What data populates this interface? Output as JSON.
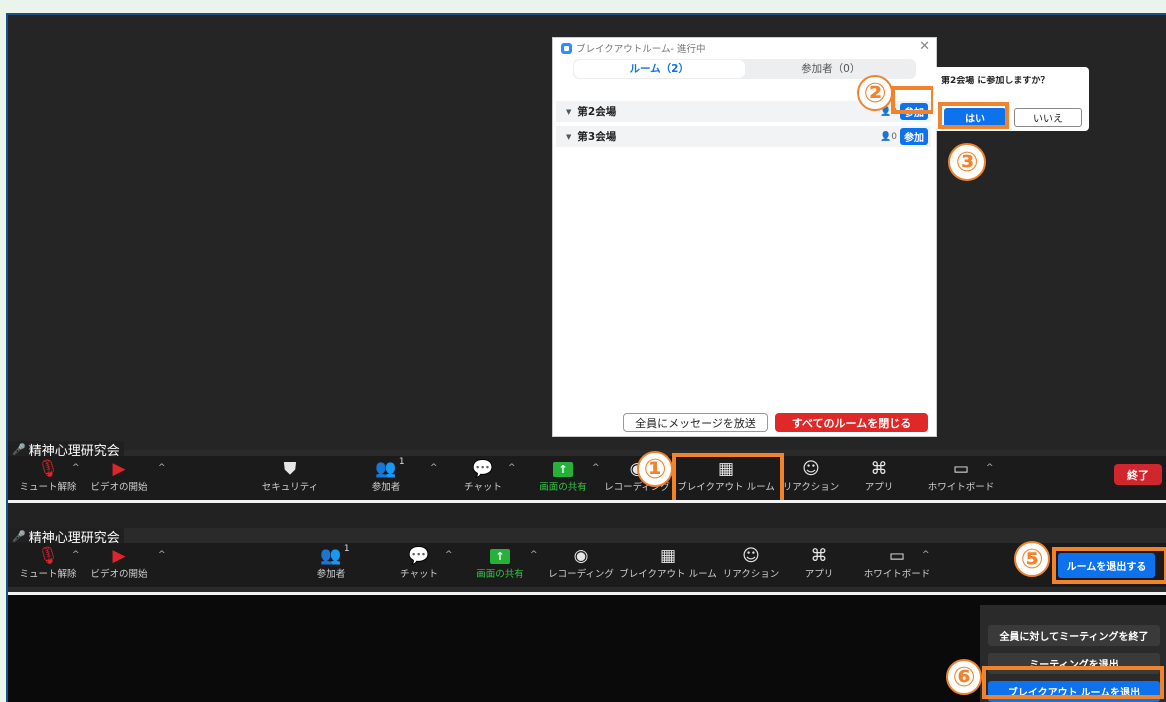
{
  "rooms_dialog": {
    "title": "ブレイクアウトルーム- 進行中",
    "tab_rooms": "ルーム（2）",
    "tab_participants": "参加者（0）",
    "rooms": [
      {
        "name": "第2会場",
        "count": "0",
        "join": "参加"
      },
      {
        "name": "第3会場",
        "count": "0",
        "join": "参加"
      }
    ],
    "broadcast": "全員にメッセージを放送",
    "close_all": "すべてのルームを閉じる"
  },
  "confirm": {
    "message": "第2会場 に参加しますか？",
    "yes": "はい",
    "no": "いいえ"
  },
  "meeting_name": "精神心理研究会",
  "toolbar_top": {
    "unmute": "ミュート解除",
    "video": "ビデオの開始",
    "security": "セキュリティ",
    "participants": "参加者",
    "participants_count": "1",
    "chat": "チャット",
    "share": "画面の共有",
    "record": "レコーディング",
    "breakout": "ブレイクアウト ルーム",
    "reaction": "リアクション",
    "apps": "アプリ",
    "whiteboard": "ホワイトボード",
    "end": "終了"
  },
  "toolbar_bottom": {
    "unmute": "ミュート解除",
    "video": "ビデオの開始",
    "participants": "参加者",
    "participants_count": "1",
    "chat": "チャット",
    "share": "画面の共有",
    "record": "レコーディング",
    "breakout": "ブレイクアウト ルーム",
    "reaction": "リアクション",
    "apps": "アプリ",
    "whiteboard": "ホワイトボード",
    "leave_room": "ルームを退出する"
  },
  "leave_menu": {
    "end_all": "全員に対してミーティングを終了",
    "leave_meeting": "ミーティングを退出",
    "leave_breakout": "ブレイクアウト ルームを退出"
  },
  "steps": [
    "①",
    "②",
    "③",
    "⑤",
    "⑥"
  ],
  "colors": {
    "accent": "#0e72ed",
    "highlight": "#f0832c",
    "danger": "#e02828",
    "share_green": "#26b13a"
  }
}
